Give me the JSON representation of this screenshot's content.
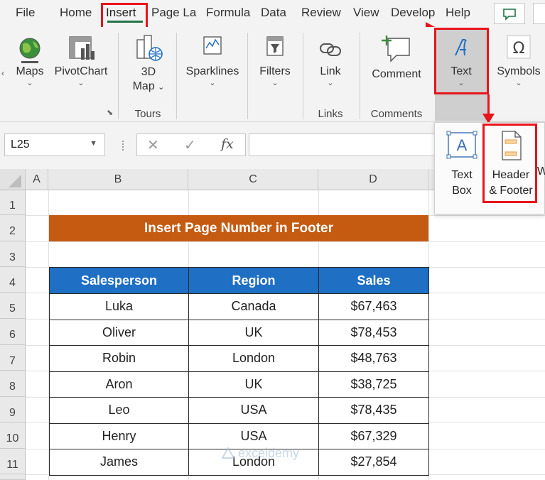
{
  "menu": {
    "tabs": [
      "File",
      "Home",
      "Insert",
      "Page La",
      "Formula",
      "Data",
      "Review",
      "View",
      "Develop",
      "Help"
    ],
    "active": "Insert"
  },
  "ribbon": {
    "maps": "Maps",
    "pivotchart": "PivotChart",
    "map3d_line1": "3D",
    "map3d_line2": "Map",
    "sparklines": "Sparklines",
    "filters": "Filters",
    "link": "Link",
    "comment": "Comment",
    "text": "Text",
    "symbols": "Symbols",
    "group_tours": "Tours",
    "group_links": "Links",
    "group_comments": "Comments"
  },
  "formula_bar": {
    "name_box": "L25",
    "cancel": "✕",
    "enter": "✓",
    "fx": "fx",
    "value": ""
  },
  "text_menu": {
    "textbox_line1": "Text",
    "textbox_line2": "Box",
    "hf_line1": "Header",
    "hf_line2": "& Footer",
    "partial": "W"
  },
  "sheet": {
    "columns": [
      "A",
      "B",
      "C",
      "D"
    ],
    "rows": [
      "1",
      "2",
      "3",
      "4",
      "5",
      "6",
      "7",
      "8",
      "9",
      "10",
      "11"
    ],
    "title": "Insert Page Number in Footer",
    "headers": [
      "Salesperson",
      "Region",
      "Sales"
    ],
    "data": [
      [
        "Luka",
        "Canada",
        "$67,463"
      ],
      [
        "Oliver",
        "UK",
        "$78,453"
      ],
      [
        "Robin",
        "London",
        "$48,763"
      ],
      [
        "Aron",
        "UK",
        "$38,725"
      ],
      [
        "Leo",
        "USA",
        "$78,435"
      ],
      [
        "Henry",
        "USA",
        "$67,329"
      ],
      [
        "James",
        "London",
        "$27,854"
      ]
    ]
  },
  "watermark": "exceldemy",
  "colors": {
    "accent_green": "#217346",
    "title_orange": "#c55a11",
    "header_blue": "#1f6fc4",
    "highlight_red": "#e8141b"
  }
}
